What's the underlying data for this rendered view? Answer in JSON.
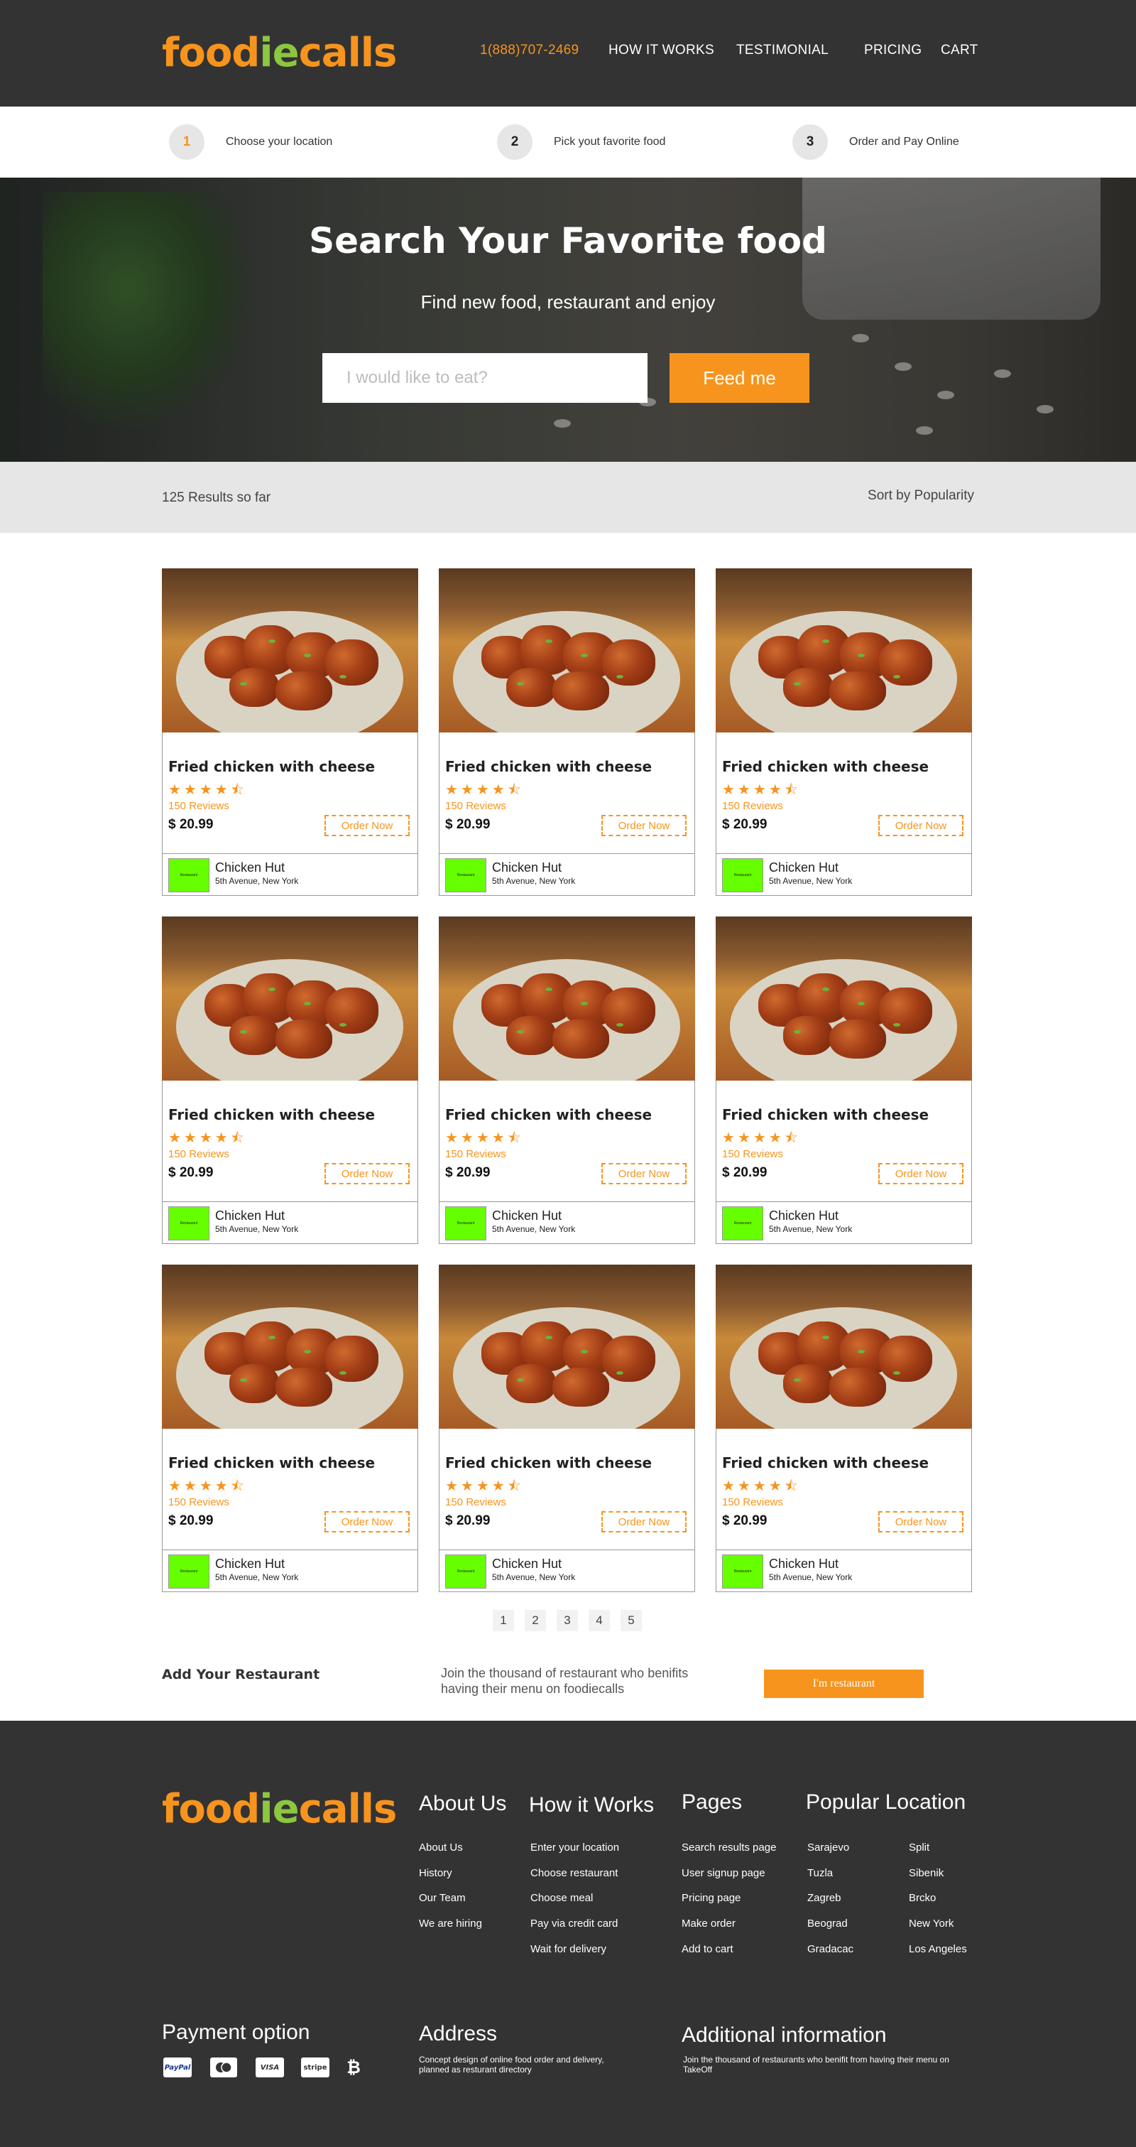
{
  "brand": {
    "part1": "food",
    "part2": "ie",
    "part3": "calls",
    "color_primary": "#f7941d",
    "color_secondary": "#8dc63f"
  },
  "nav": {
    "phone": "1(888)707-2469",
    "how_it_works": "HOW IT WORKS",
    "testimonial": "TESTIMONIAL",
    "pricing": "PRICING",
    "cart": "CART"
  },
  "steps": [
    {
      "number": "1",
      "label": "Choose your location"
    },
    {
      "number": "2",
      "label": "Pick yout favorite food"
    },
    {
      "number": "3",
      "label": "Order and Pay Online"
    }
  ],
  "hero": {
    "title": "Search Your Favorite food",
    "subtitle": "Find new food, restaurant and enjoy",
    "search_placeholder": "I would like to eat?",
    "search_button": "Feed me"
  },
  "results": {
    "count_label": "125 Results so far",
    "sort_label": "Sort by Popularity"
  },
  "cards": [
    {
      "title": "Fried chicken with cheese",
      "rating": 4.5,
      "stars": "★★★★⯪",
      "reviews": "150 Reviews",
      "price": "$ 20.99",
      "order_label": "Order Now",
      "restaurant": "Chicken Hut",
      "address": "5th Avenue, New York",
      "logo_text": "Restaurant"
    },
    {
      "title": "Fried chicken with cheese",
      "rating": 4.5,
      "stars": "★★★★⯪",
      "reviews": "150 Reviews",
      "price": "$ 20.99",
      "order_label": "Order Now",
      "restaurant": "Chicken Hut",
      "address": "5th Avenue, New York",
      "logo_text": "Restaurant"
    },
    {
      "title": "Fried chicken with cheese",
      "rating": 4.5,
      "stars": "★★★★⯪",
      "reviews": "150 Reviews",
      "price": "$ 20.99",
      "order_label": "Order Now",
      "restaurant": "Chicken Hut",
      "address": "5th Avenue, New York",
      "logo_text": "Restaurant"
    },
    {
      "title": "Fried chicken with cheese",
      "rating": 4.5,
      "stars": "★★★★⯪",
      "reviews": "150 Reviews",
      "price": "$ 20.99",
      "order_label": "Order Now",
      "restaurant": "Chicken Hut",
      "address": "5th Avenue, New York",
      "logo_text": "Restaurant"
    },
    {
      "title": "Fried chicken with cheese",
      "rating": 4.5,
      "stars": "★★★★⯪",
      "reviews": "150 Reviews",
      "price": "$ 20.99",
      "order_label": "Order Now",
      "restaurant": "Chicken Hut",
      "address": "5th Avenue, New York",
      "logo_text": "Restaurant"
    },
    {
      "title": "Fried chicken with cheese",
      "rating": 4.5,
      "stars": "★★★★⯪",
      "reviews": "150 Reviews",
      "price": "$ 20.99",
      "order_label": "Order Now",
      "restaurant": "Chicken Hut",
      "address": "5th Avenue, New York",
      "logo_text": "Restaurant"
    },
    {
      "title": "Fried chicken with cheese",
      "rating": 4.5,
      "stars": "★★★★⯪",
      "reviews": "150 Reviews",
      "price": "$ 20.99",
      "order_label": "Order Now",
      "restaurant": "Chicken Hut",
      "address": "5th Avenue, New York",
      "logo_text": "Restaurant"
    },
    {
      "title": "Fried chicken with cheese",
      "rating": 4.5,
      "stars": "★★★★⯪",
      "reviews": "150 Reviews",
      "price": "$ 20.99",
      "order_label": "Order Now",
      "restaurant": "Chicken Hut",
      "address": "5th Avenue, New York",
      "logo_text": "Restaurant"
    },
    {
      "title": "Fried chicken with cheese",
      "rating": 4.5,
      "stars": "★★★★⯪",
      "reviews": "150 Reviews",
      "price": "$ 20.99",
      "order_label": "Order Now",
      "restaurant": "Chicken Hut",
      "address": "5th Avenue, New York",
      "logo_text": "Restaurant"
    }
  ],
  "pagination": [
    "1",
    "2",
    "3",
    "4",
    "5"
  ],
  "add_restaurant": {
    "title": "Add Your Restaurant",
    "description": "Join the thousand of restaurant who benifits having their menu on foodiecalls",
    "button": "I'm restaurant"
  },
  "footer": {
    "about": {
      "heading": "About Us",
      "links": [
        "About Us",
        "History",
        "Our Team",
        "We are hiring"
      ]
    },
    "how": {
      "heading": "How it Works",
      "links": [
        "Enter your location",
        "Choose restaurant",
        "Choose meal",
        "Pay via credit card",
        "Wait for delivery"
      ]
    },
    "pages": {
      "heading": "Pages",
      "links": [
        "Search results page",
        "User signup page",
        "Pricing page",
        "Make order",
        "Add to cart"
      ]
    },
    "popular": {
      "heading": "Popular Location",
      "col1": [
        "Sarajevo",
        "Tuzla",
        "Zagreb",
        "Beograd",
        "Gradacac"
      ],
      "col2": [
        "Split",
        "Sibenik",
        "Brcko",
        "New York",
        "Los Angeles"
      ]
    },
    "payment": {
      "heading": "Payment option",
      "methods": [
        "PayPal",
        "MasterCard",
        "VISA",
        "stripe",
        "₿"
      ]
    },
    "address": {
      "heading": "Address",
      "text": "Concept design of online food order and delivery, planned as resturant directory"
    },
    "additional": {
      "heading": "Additional information",
      "text": "Join the thousand of restaurants who benifit from having their menu on TakeOff"
    }
  }
}
